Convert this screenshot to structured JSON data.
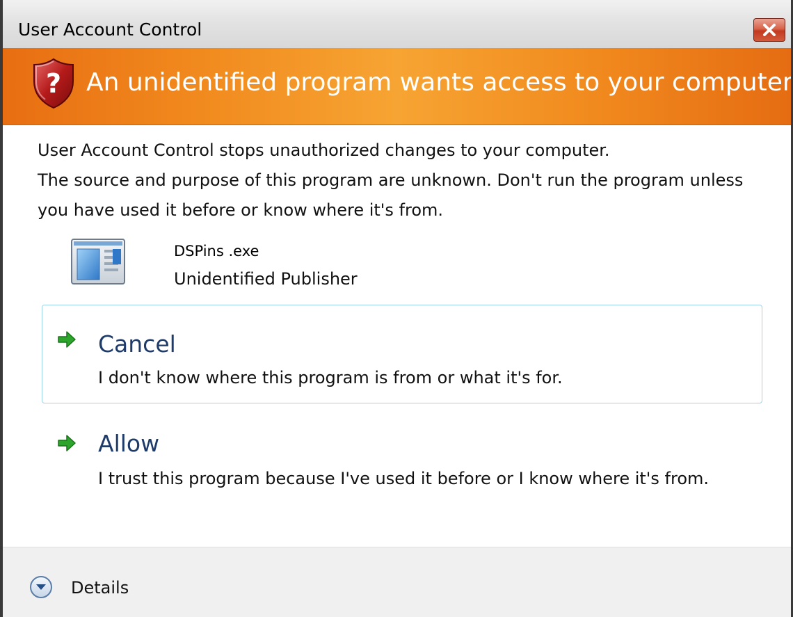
{
  "window": {
    "title": "User Account Control"
  },
  "banner": {
    "heading": "An unidentified program wants access to your computer"
  },
  "description": {
    "line1": "User Account Control stops unauthorized changes to your computer.",
    "line2": "The source and purpose of this program are unknown.  Don't run the program unless you have used it before or know where it's from."
  },
  "program": {
    "name": "DSPins .exe",
    "publisher": "Unidentified Publisher"
  },
  "options": [
    {
      "label": "Cancel",
      "description": "I don't know where this program is from or what it's for."
    },
    {
      "label": "Allow",
      "description": "I trust this program because I've used it before or I know where it's from."
    }
  ],
  "footer": {
    "details_label": "Details"
  },
  "colors": {
    "banner_orange": "#f18a1e",
    "option_title_blue": "#1e3b6a",
    "arrow_green": "#2da52d",
    "selected_border": "#9ed3ee"
  },
  "icons": {
    "shield": "security-shield-question-icon",
    "program": "application-window-icon",
    "arrow": "green-arrow-right-icon",
    "close": "close-x-icon",
    "details": "chevron-down-circle-icon"
  }
}
